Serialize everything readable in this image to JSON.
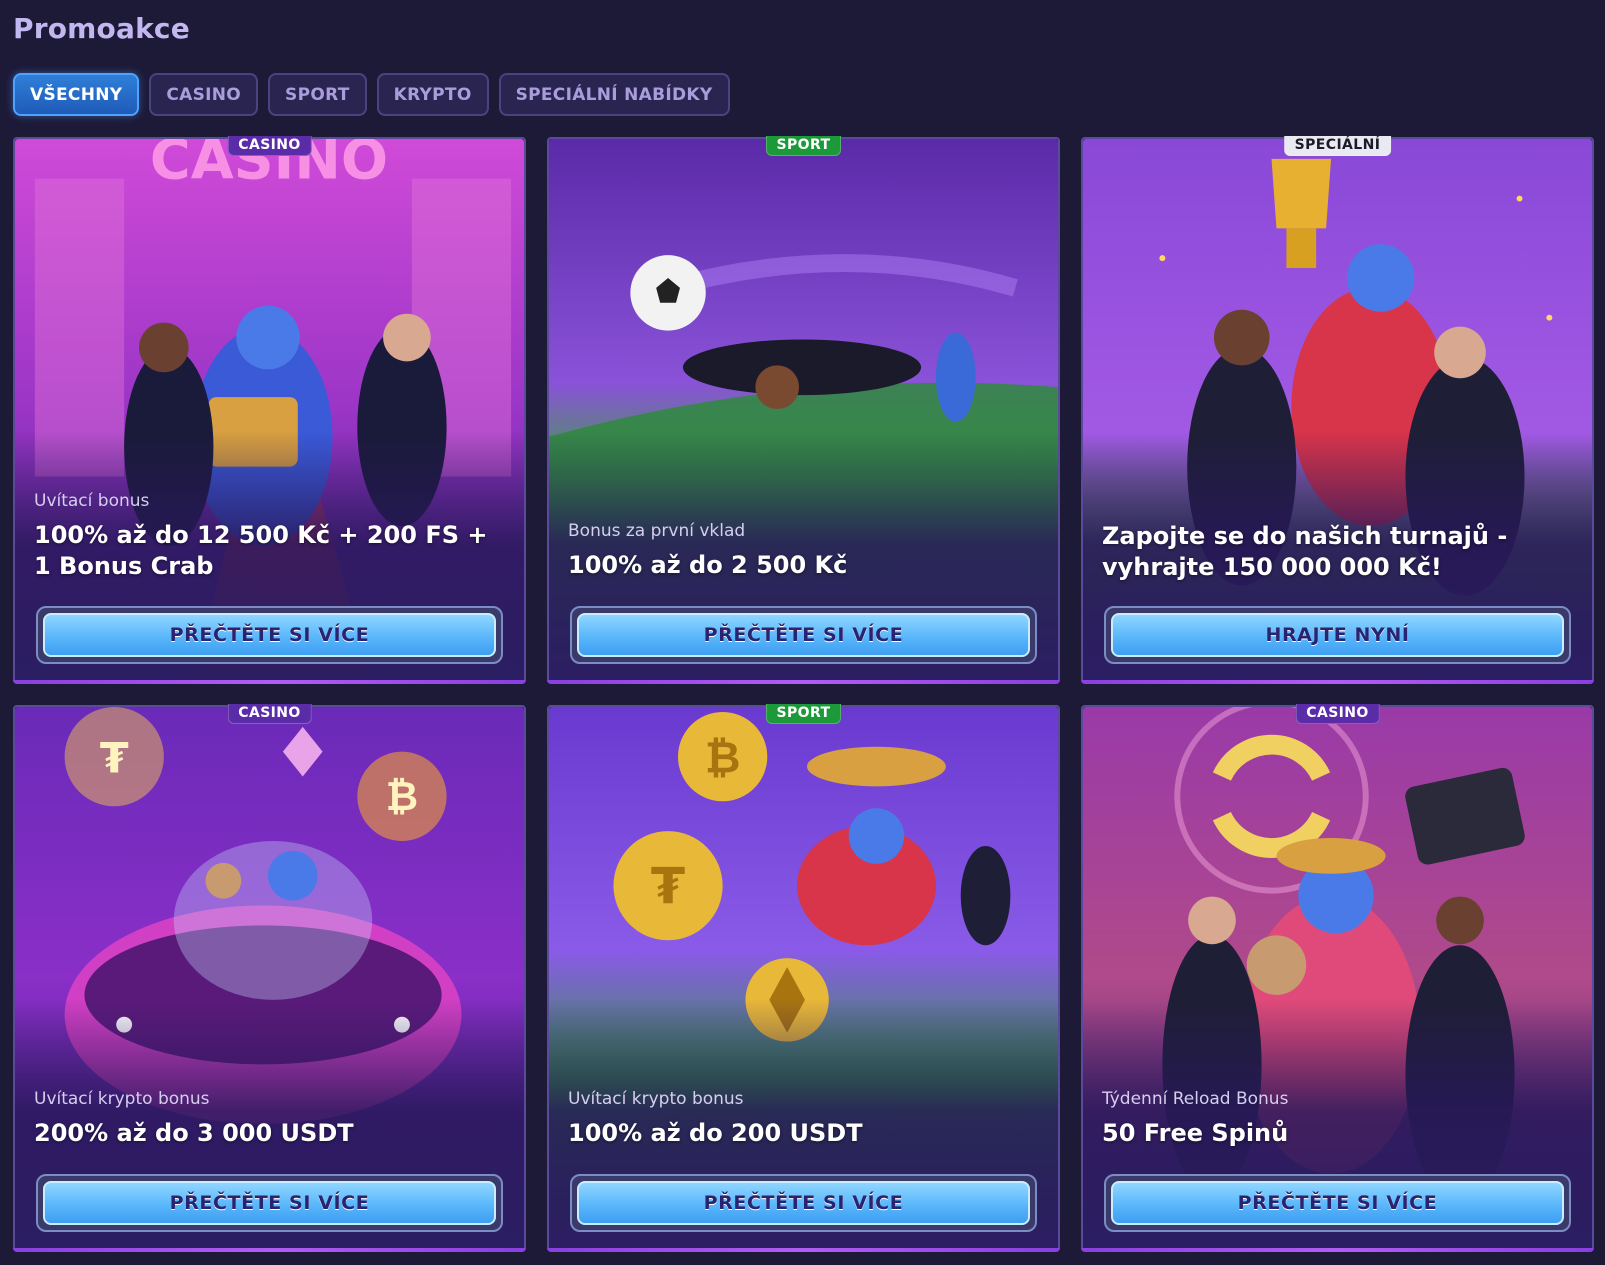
{
  "page": {
    "title": "Promoakce"
  },
  "tabs": [
    {
      "label": "VŠECHNY",
      "active": true
    },
    {
      "label": "CASINO",
      "active": false
    },
    {
      "label": "SPORT",
      "active": false
    },
    {
      "label": "KRYPTO",
      "active": false
    },
    {
      "label": "SPECIÁLNÍ NABÍDKY",
      "active": false
    }
  ],
  "cards": [
    {
      "badge": "CASINO",
      "badge_type": "casino",
      "subtitle": "Uvítací bonus",
      "title": "100% až do 12 500 Kč + 200 FS + 1 Bonus Crab",
      "button": "PŘEČTĚTE SI VÍCE",
      "art_sign": "CASINO",
      "palette": [
        "#c33bd6",
        "#6a2bb0",
        "#e259c8"
      ]
    },
    {
      "badge": "SPORT",
      "badge_type": "sport",
      "subtitle": "Bonus za první vklad",
      "title": "100% až do 2 500 Kč",
      "button": "PŘEČTĚTE SI VÍCE",
      "art_sign": "",
      "palette": [
        "#5b2bb5",
        "#7a46d8",
        "#2d8a3a"
      ]
    },
    {
      "badge": "SPECIÁLNÍ",
      "badge_type": "special",
      "subtitle": "",
      "title": "Zapojte se do našich turnajů - vyhrajte 150 000 000 Kč!",
      "button": "HRAJTE NYNÍ",
      "art_sign": "",
      "palette": [
        "#7a3fd0",
        "#a35ae6",
        "#3c8a3a"
      ]
    },
    {
      "badge": "CASINO",
      "badge_type": "casino",
      "subtitle": "Uvítací krypto bonus",
      "title": "200% až do 3 000 USDT",
      "button": "PŘEČTĚTE SI VÍCE",
      "art_sign": "",
      "palette": [
        "#8a2fc8",
        "#5a2aa8",
        "#d13fc4"
      ]
    },
    {
      "badge": "SPORT",
      "badge_type": "sport",
      "subtitle": "Uvítací krypto bonus",
      "title": "100% až do 200 USDT",
      "button": "PŘEČTĚTE SI VÍCE",
      "art_sign": "",
      "palette": [
        "#6a3ad0",
        "#8a5ae8",
        "#2f9a3e"
      ]
    },
    {
      "badge": "CASINO",
      "badge_type": "casino",
      "subtitle": "Týdenní Reload Bonus",
      "title": "50 Free Spinů",
      "button": "PŘEČTĚTE SI VÍCE",
      "art_sign": "",
      "palette": [
        "#b0387a",
        "#6a2ab0",
        "#e06a9a"
      ]
    }
  ]
}
